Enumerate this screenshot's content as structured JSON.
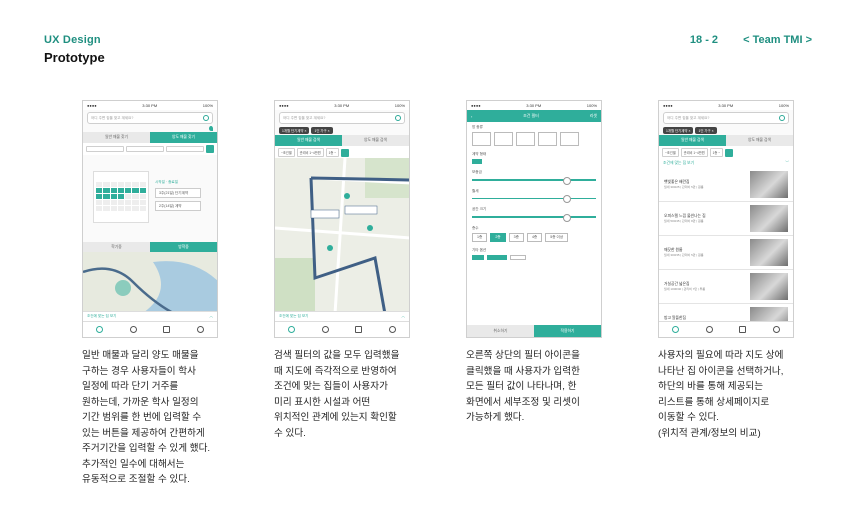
{
  "header": {
    "section": "UX Design",
    "title": "Prototype",
    "page_number": "18 - 2",
    "team": "< Team TMI >"
  },
  "phone": {
    "time": "3:30 PM",
    "battery": "100%",
    "carrier": "●●●●",
    "search_placeholder": "어디 주변 집을 찾고 계세요?"
  },
  "phone1": {
    "tab_general": "일반 매물 찾기",
    "tab_transfer": "양도 매물 찾기",
    "pick_start": "시작일",
    "pick_end": "종료일",
    "box1": "3주(21일) 단기계약",
    "box2": "2주(14일) 계약",
    "period_tab": "학기중",
    "vacation_tab": "방학중",
    "bottom_label": "조건에 맞는 집 보기"
  },
  "phone2": {
    "chip1": "1개월 단기계약 ×",
    "chip2": "1인 가구 ×",
    "tab_general": "일반 매물 검색",
    "tab_transfer": "양도 매물 검색",
    "filter1": "~조건별",
    "filter2": "관리비 1~4만원",
    "filter3": "1층 ~",
    "bottom_label": "조건에 맞는 집 보기"
  },
  "phone3": {
    "title": "조건 필터",
    "reset": "리셋",
    "section_type": "방 종류",
    "section_contract": "계약 형태",
    "section_deposit": "보증금",
    "section_rent": "월세",
    "section_area": "공간 크기",
    "section_floor": "층수",
    "section_option": "기타 옵션",
    "floors": [
      "1층",
      "2층",
      "3층",
      "4층",
      "5층 이상"
    ],
    "cancel": "취소하기",
    "apply": "적용하기"
  },
  "phone4": {
    "chip1": "1개월 단기계약 ×",
    "chip2": "1인 가구 ×",
    "tab_general": "일반 매물 검색",
    "tab_transfer": "양도 매물 검색",
    "list_title": "조건에 맞는 집 보기",
    "listings": [
      {
        "name": "햇빛좋은 배란집",
        "meta": "월세 300/25 | 관리비 5만 | 원룸"
      },
      {
        "name": "오피스텔 느낌 물씬나는 집",
        "meta": "월세 500/45 | 관리비 8만 | 원룸"
      },
      {
        "name": "깨끗한 원룸",
        "meta": "월세 300/35 | 관리비 5만 | 원룸"
      },
      {
        "name": "거실공간 넓은집",
        "meta": "월세 1000/40 | 관리비 7만 | 투룸"
      },
      {
        "name": "방고 알뜰한집",
        "meta": "월세 200/30 | 관리비 4만 | 원룸"
      }
    ]
  },
  "captions": {
    "c1": "일반 매물과 달리 양도 매물을\n구하는 경우 사용자들이 학사\n일정에 따라 단기 거주를\n원하는데, 가까운 학사 일정의\n기간 범위를 한 번에 입력할 수\n있는 버튼을 제공하여 간편하게\n주거기간을 입력할 수 있게 했다.\n추가적인 일수에 대해서는\n유동적으로 조절할 수 있다.",
    "c2": "검색 필터의 값을 모두 입력했을\n때 지도에 즉각적으로 반영하여\n조건에 맞는 집들이 사용자가\n미리 표시한 시설과 어떤\n위치적인 관계에 있는지 확인할\n수 있다.",
    "c3": "오른쪽 상단의 필터 아이콘을\n클릭했을 때 사용자가 입력한\n모든 필터 값이 나타나며, 한\n화면에서 세부조정 및 리셋이\n가능하게 했다.",
    "c4": "사용자의 필요에 따라 지도 상에\n나타난 집 아이콘을 선택하거나,\n하단의 바를 통해 제공되는\n리스트를 통해 상세페이지로\n이동할 수 있다.\n(위치적 관계/정보의 비교)"
  },
  "colors": {
    "accent": "#2fae9b",
    "heading_accent": "#1f8f80"
  }
}
